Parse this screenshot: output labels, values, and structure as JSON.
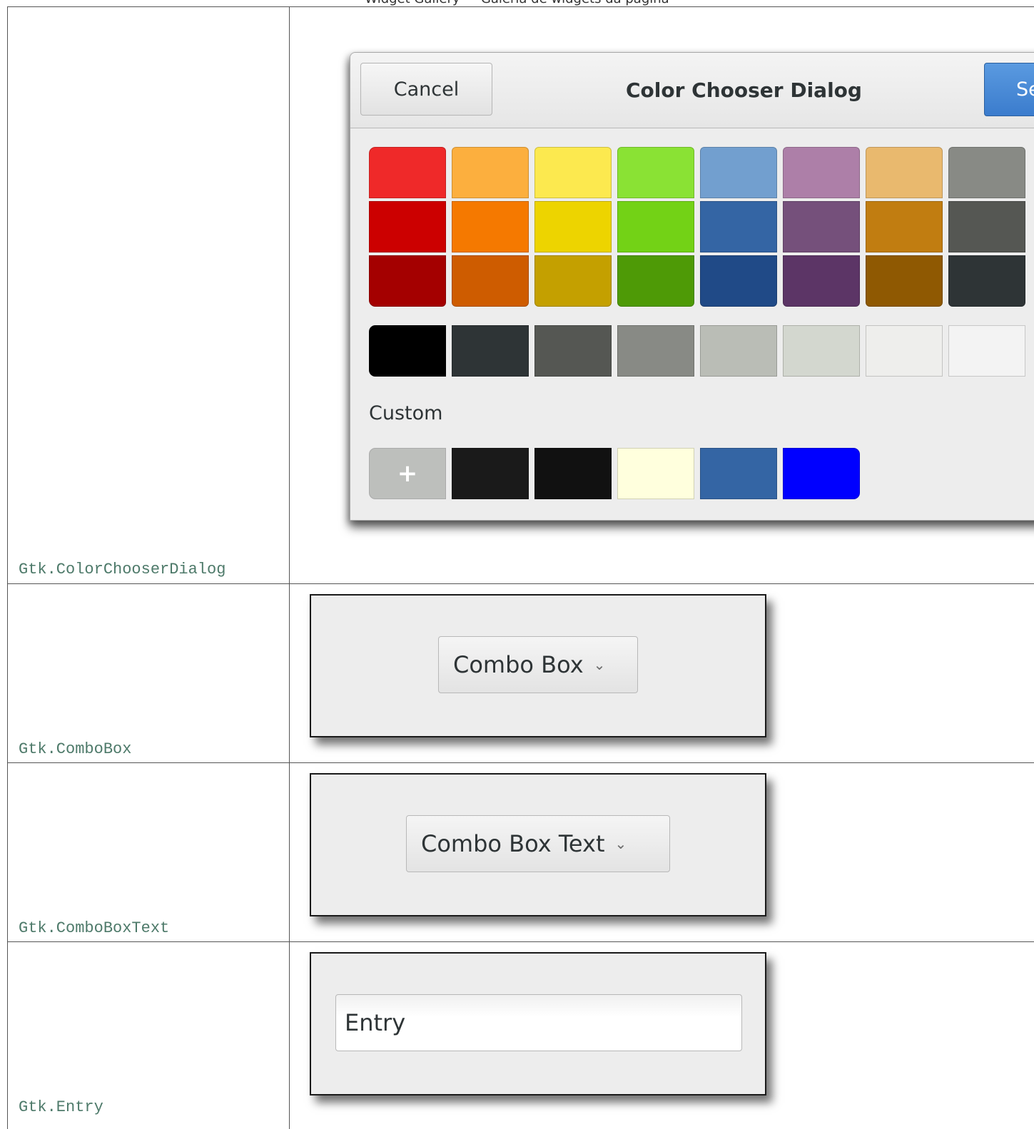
{
  "page": {
    "top_caption": "Widget Gallery — Galeria de widgets da página"
  },
  "rows": [
    {
      "label": "Gtk.ColorChooserDialog"
    },
    {
      "label": "Gtk.ComboBox"
    },
    {
      "label": "Gtk.ComboBoxText"
    },
    {
      "label": "Gtk.Entry"
    }
  ],
  "color_dialog": {
    "cancel_label": "Cancel",
    "title": "Color Chooser Dialog",
    "select_label": "Select",
    "palette_rows": [
      [
        "#ef2929",
        "#fcaf3e",
        "#fce94f",
        "#8ae234",
        "#729fcf",
        "#ad7fa8",
        "#e9b96e",
        "#888a85"
      ],
      [
        "#cc0000",
        "#f57900",
        "#edd400",
        "#73d216",
        "#3465a4",
        "#75507b",
        "#c17d11",
        "#555753"
      ],
      [
        "#a40000",
        "#ce5c00",
        "#c4a000",
        "#4e9a06",
        "#204a87",
        "#5c3566",
        "#8f5902",
        "#2e3436"
      ]
    ],
    "grays": [
      "#000000",
      "#2e3436",
      "#555753",
      "#888a85",
      "#babdb6",
      "#d3d7cf",
      "#eeeeec",
      "#f3f3f3"
    ],
    "custom_label": "Custom",
    "add_label": "+",
    "custom_colors": [
      "#1a1a1a",
      "#111111",
      "#ffffdd",
      "#3465a4",
      "#0000ff"
    ]
  },
  "combo_box": {
    "label": "Combo Box",
    "arrow": "⌄"
  },
  "combo_box_text": {
    "label": "Combo Box Text",
    "arrow": "⌄"
  },
  "entry": {
    "value": "Entry"
  }
}
